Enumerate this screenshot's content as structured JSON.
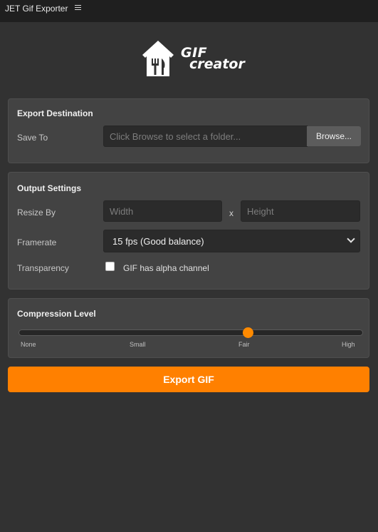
{
  "window": {
    "title": "JET Gif Exporter",
    "menu_icon": "hamburger-icon"
  },
  "logo": {
    "line1": "GIF",
    "line2": "creator",
    "icon": "house-fork-knife-icon"
  },
  "export_destination": {
    "title": "Export Destination",
    "save_to_label": "Save To",
    "folder_placeholder": "Click Browse to select a folder...",
    "browse_label": "Browse..."
  },
  "output_settings": {
    "title": "Output Settings",
    "resize_label": "Resize By",
    "width_placeholder": "Width",
    "separator": "x",
    "height_placeholder": "Height",
    "framerate_label": "Framerate",
    "framerate_value": "15 fps (Good balance)",
    "transparency_label": "Transparency",
    "alpha_checkbox_label": "GIF has alpha channel",
    "alpha_checked": false
  },
  "compression": {
    "title": "Compression Level",
    "ticks": [
      "None",
      "Small",
      "Fair",
      "High"
    ],
    "selected_index": 2,
    "accent_color": "#ff8a00"
  },
  "export_button": {
    "label": "Export GIF",
    "color": "#ff8000"
  }
}
